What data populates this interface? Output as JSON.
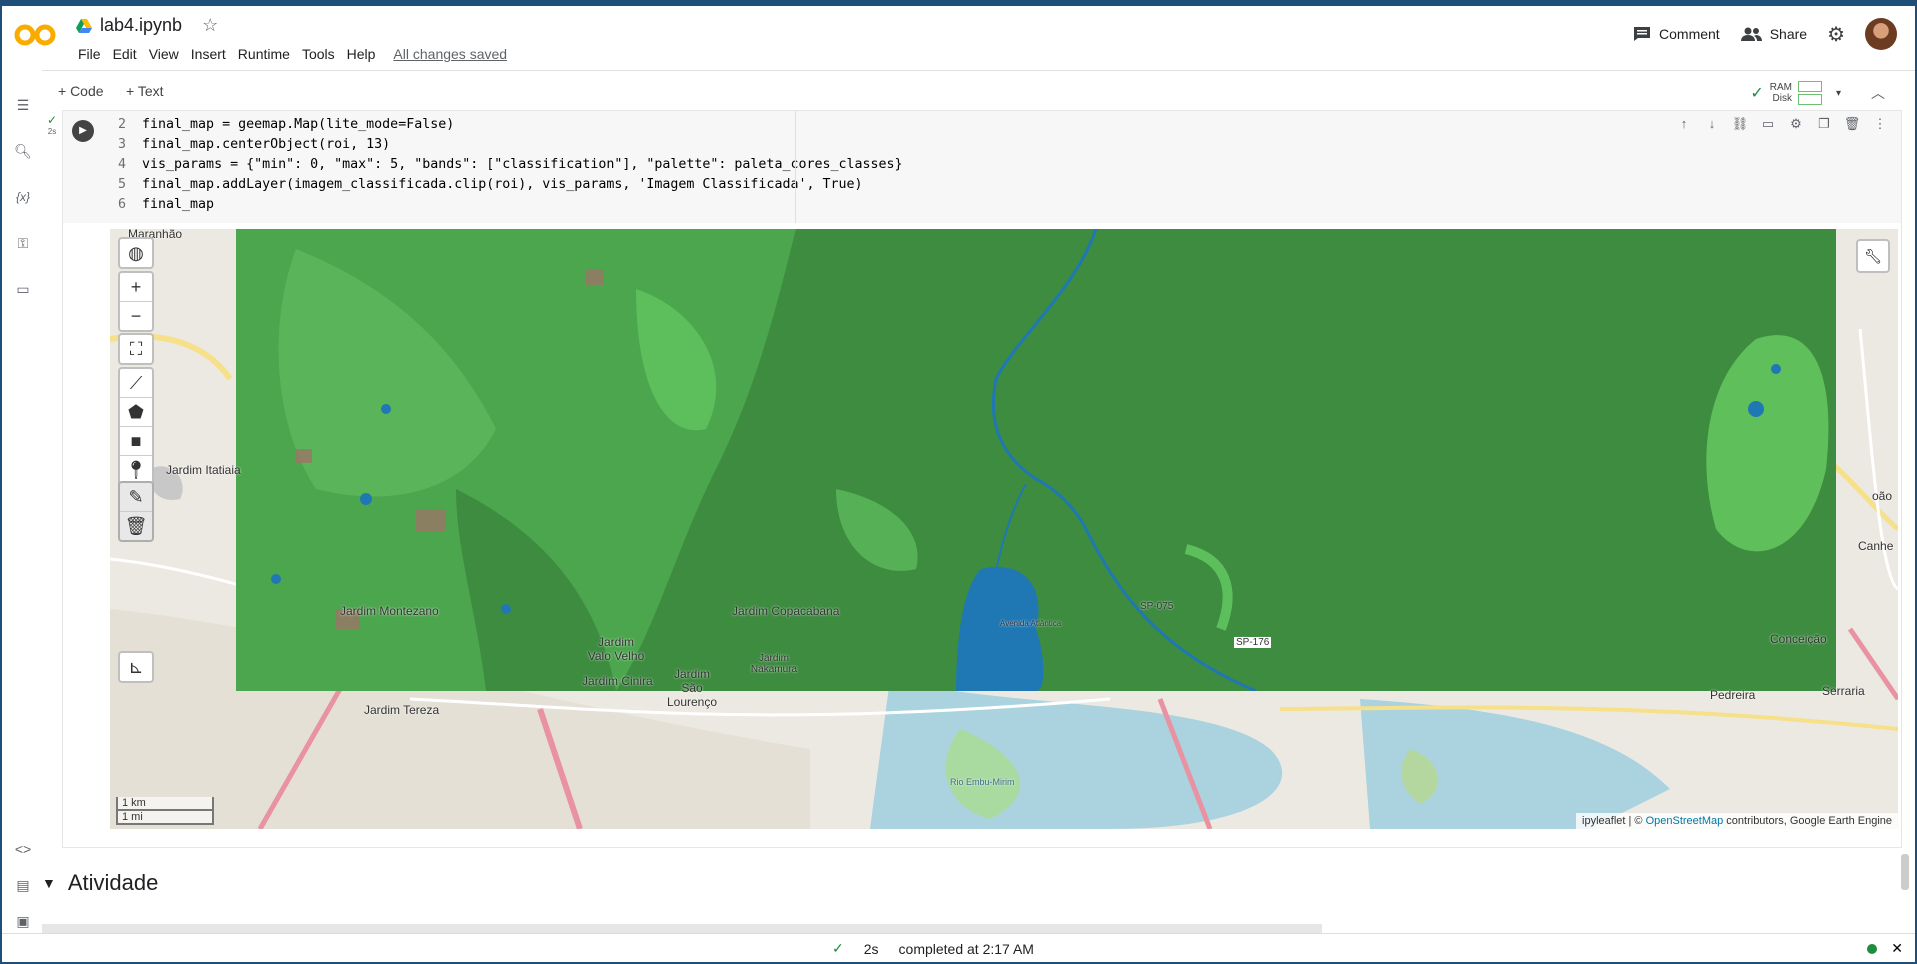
{
  "app": {
    "title": "lab4.ipynb"
  },
  "menu": [
    "File",
    "Edit",
    "View",
    "Insert",
    "Runtime",
    "Tools",
    "Help"
  ],
  "save_status": "All changes saved",
  "header_actions": {
    "comment": "Comment",
    "share": "Share"
  },
  "toolbar": {
    "code": "+ Code",
    "text": "+ Text",
    "ram": "RAM",
    "disk": "Disk"
  },
  "cell": {
    "exec_time": "2s",
    "lines": [
      {
        "n": "2",
        "text": "final_map = geemap.Map(lite_mode=False)"
      },
      {
        "n": "3",
        "text": "final_map.centerObject(roi, 13)"
      },
      {
        "n": "4",
        "text": "vis_params = {\"min\": 0, \"max\": 5, \"bands\": [\"classification\"], \"palette\": paleta_cores_classes}"
      },
      {
        "n": "5",
        "text": "final_map.addLayer(imagem_classificada.clip(roi), vis_params, 'Imagem Classificada', True)"
      },
      {
        "n": "6",
        "text": "final_map"
      }
    ]
  },
  "map": {
    "zoom_in": "+",
    "zoom_out": "−",
    "attribution_prefix": "ipyleaflet | © ",
    "attribution_link": "OpenStreetMap",
    "attribution_suffix": " contributors, Google Earth Engine",
    "scale_km": "1 km",
    "scale_mi": "1 mi",
    "places": [
      "Maranhão",
      "Jardim Itatiaia",
      "Jardim Montezano",
      "Jardim Copacabana",
      "Jardim Valo Velho",
      "Jardim Cinira",
      "Jardim São Lourenço",
      "Jardim Nakamura",
      "Jardim Tereza",
      "Conceição",
      "Pedreira",
      "Serraria",
      "Canhe",
      "oão",
      "SP-176",
      "SP-075",
      "Rio Embu-Mirim",
      "Avenida Atlântica"
    ]
  },
  "section": {
    "title": "Atividade"
  },
  "status": {
    "time": "2s",
    "completed": "completed at 2:17 AM"
  }
}
